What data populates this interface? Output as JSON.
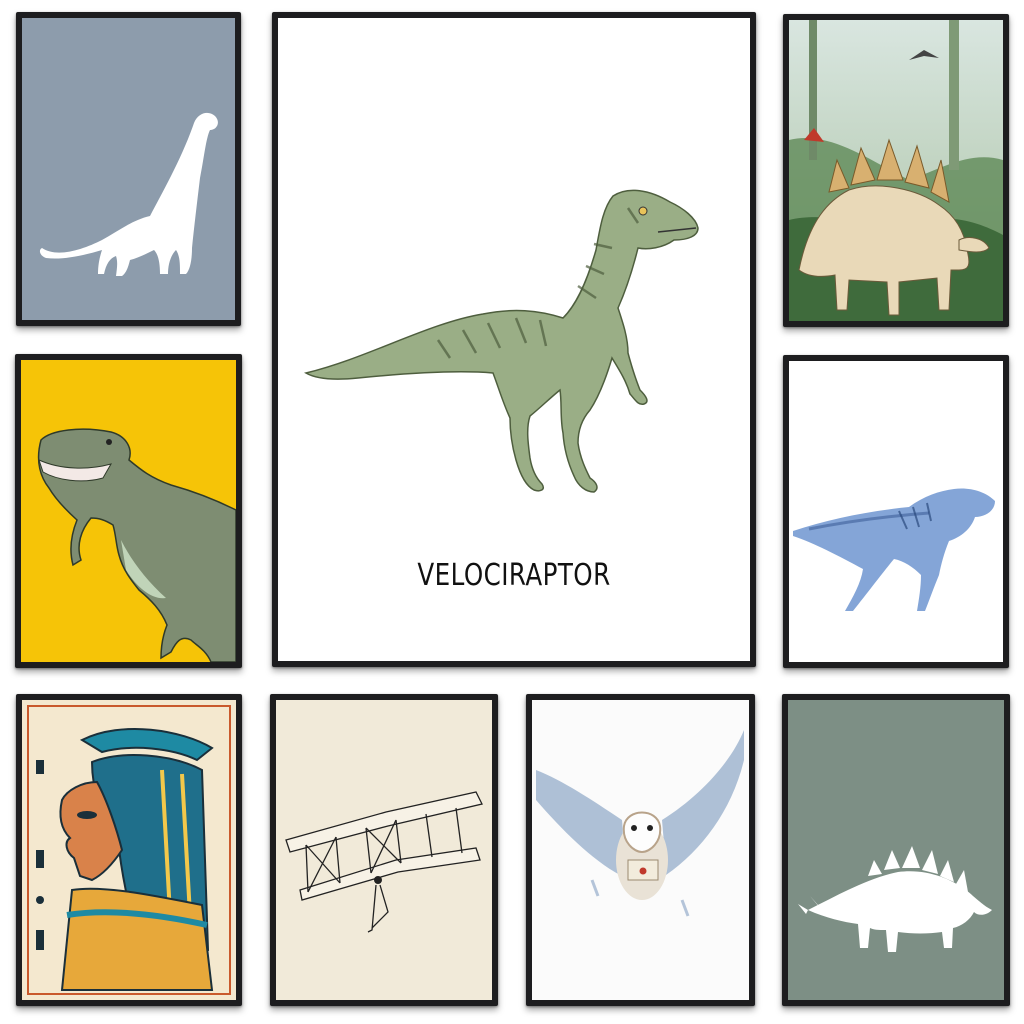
{
  "gallery": {
    "featured_poster": {
      "title": "VELOCIRAPTOR"
    }
  },
  "colors": {
    "frame": "#1d1d1f",
    "blue_gray": "#8d9cac",
    "mustard": "#f6c407",
    "sage": "#7d8f85",
    "paper": "#f1ead9",
    "raptor_green": "#8fa47c",
    "watercolor_blue": "#6f95d0"
  }
}
